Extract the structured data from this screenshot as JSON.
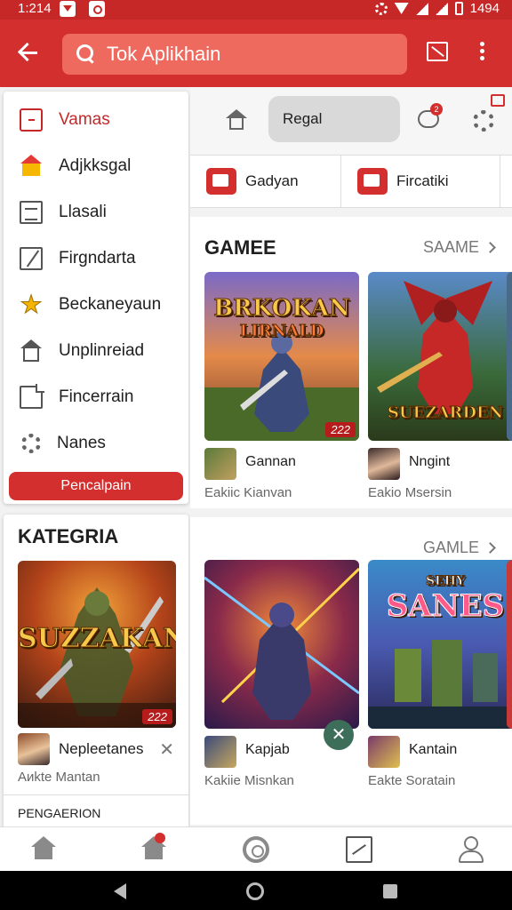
{
  "status_bar": {
    "time": "1:214",
    "battery_text": "1494"
  },
  "app_bar": {
    "search_placeholder": "Tok Aplikhain"
  },
  "drawer": {
    "items": [
      {
        "label": "Vamas",
        "icon": "clipboard-icon",
        "active": true
      },
      {
        "label": "Adjkksgal",
        "icon": "house-icon"
      },
      {
        "label": "Llasali",
        "icon": "list-icon"
      },
      {
        "label": "Firgndarta",
        "icon": "edit-icon"
      },
      {
        "label": "Beckaneyaun",
        "icon": "star-icon"
      },
      {
        "label": "Unplinreiad",
        "icon": "home-outline-icon"
      },
      {
        "label": "Fincerrain",
        "icon": "document-icon"
      },
      {
        "label": "Nanes",
        "icon": "gear-icon"
      }
    ],
    "button_label": "Pencalpain"
  },
  "kategoria": {
    "title": "KATEGRIA",
    "art_title": "SUZZAKAN",
    "art_subtitle": "",
    "price": "222",
    "item_name": "Nepleetanes",
    "item_sub": "Aиkte Mantan",
    "footer": "PENGAERION"
  },
  "toolbar": {
    "chip_label": "Regal",
    "chat_badge": "2"
  },
  "tabs": [
    {
      "label": "Gadyan",
      "icon": "mail-icon"
    },
    {
      "label": "Fircatiki",
      "icon": "rocket-icon"
    }
  ],
  "sections": [
    {
      "title": "GAMEE",
      "link": "SAAME",
      "games": [
        {
          "art_title": "BRKOKAN",
          "art_sub": "LIRNALD",
          "price": "222",
          "name": "Gannan",
          "sub": "Eakiic Kianvan",
          "avatar_color": "#5a7a3a"
        },
        {
          "art_title": "SUEZARDEN",
          "art_sub": "",
          "price": "",
          "name": "Nngint",
          "sub": "Eakio Msersin",
          "avatar_color": "#6a4a3a"
        }
      ]
    },
    {
      "title": "",
      "link": "GAMLE",
      "games": [
        {
          "art_title": "",
          "art_sub": "",
          "price": "",
          "name": "Kapjab",
          "sub": "Kakiie Misnkan",
          "avatar_color": "#3a4a7a"
        },
        {
          "art_title": "SANES",
          "art_sub": "SEHY",
          "price": "",
          "name": "Kantain",
          "sub": "Eakte Soratain",
          "avatar_color": "#7a3a6a"
        }
      ]
    }
  ],
  "colors": {
    "primary": "#d32f2f",
    "status_bar": "#c62828",
    "gold": "#f7c84a"
  }
}
